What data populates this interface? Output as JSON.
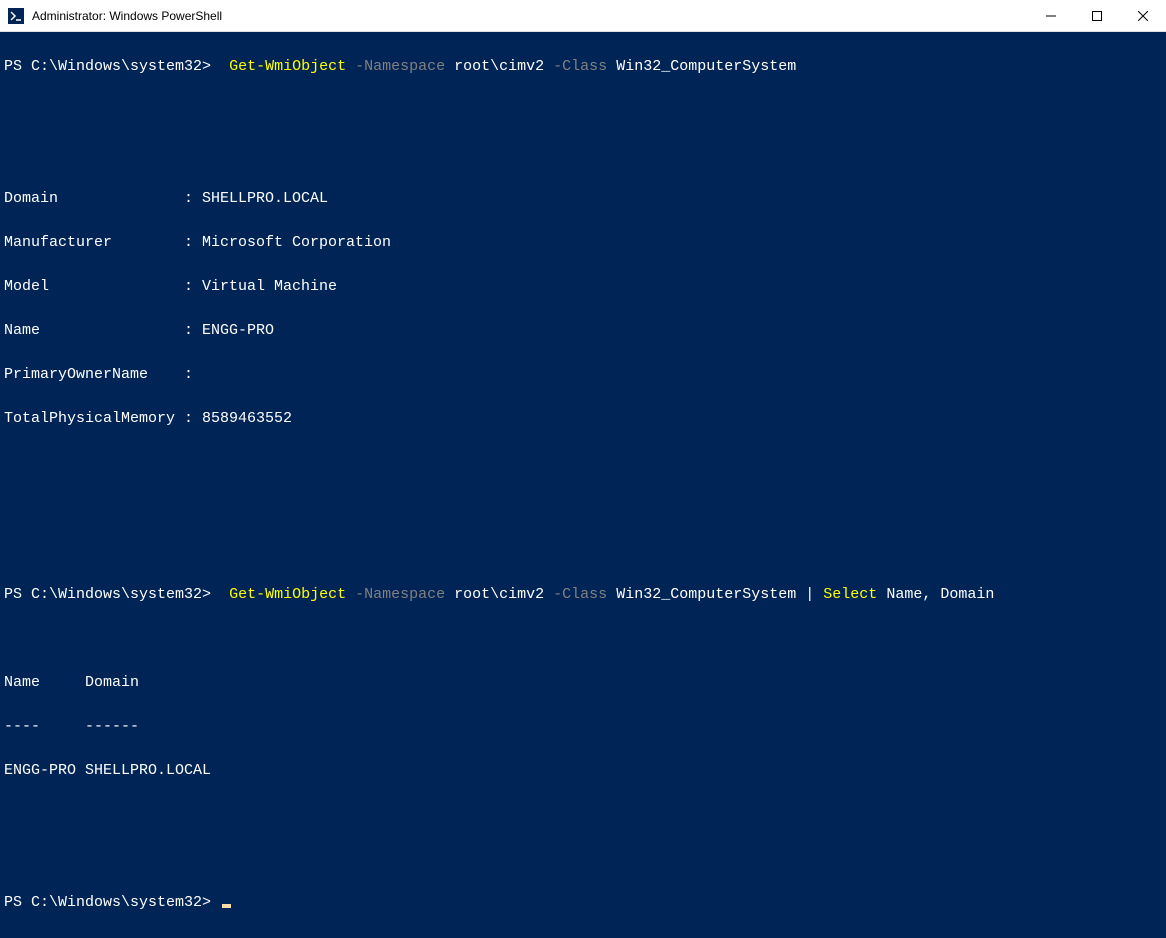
{
  "window": {
    "title": "Administrator: Windows PowerShell"
  },
  "terminal": {
    "prompt": "PS C:\\Windows\\system32>",
    "cmd1": {
      "cmdlet": "Get-WmiObject",
      "param1": "-Namespace",
      "arg1": "root\\cimv2",
      "param2": "-Class",
      "arg2": "Win32_ComputerSystem"
    },
    "out1": {
      "l1": "Domain              : SHELLPRO.LOCAL",
      "l2": "Manufacturer        : Microsoft Corporation",
      "l3": "Model               : Virtual Machine",
      "l4": "Name                : ENGG-PRO",
      "l5": "PrimaryOwnerName    :",
      "l6": "TotalPhysicalMemory : 8589463552"
    },
    "cmd2": {
      "cmdlet": "Get-WmiObject",
      "param1": "-Namespace",
      "arg1": "root\\cimv2",
      "param2": "-Class",
      "arg2": "Win32_ComputerSystem",
      "pipe": "|",
      "cmdlet2": "Select",
      "arg3": "Name",
      "comma": ",",
      "arg4": "Domain"
    },
    "out2": {
      "h1": "Name     Domain",
      "h2": "----     ------",
      "r1": "ENGG-PRO SHELLPRO.LOCAL"
    }
  }
}
